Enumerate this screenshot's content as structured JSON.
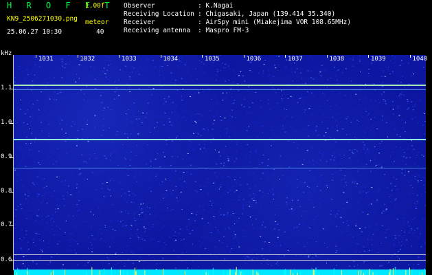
{
  "header": {
    "app_title": "H R O F F T",
    "version": "1.00f",
    "filename": "KN9_2506271030.png",
    "mode": "meteor",
    "datetime": "25.06.27 10:30",
    "count": "40",
    "meta": [
      {
        "label": "Observer",
        "value": ": K.Nagai"
      },
      {
        "label": "Receiving Location",
        "value": ": Chigasaki, Japan (139.414 35.340)"
      },
      {
        "label": "Receiver",
        "value": ": AirSpy mini (Miakejima VOR 108.65MHz)"
      },
      {
        "label": "Receiving antenna",
        "value": ": Maspro FM-3"
      }
    ]
  },
  "plot": {
    "y_unit": "kHz",
    "y_ticks": [
      "1.1",
      "1.0",
      "0.9",
      "0.8",
      "0.7",
      "0.6"
    ],
    "x_ticks": [
      "1031",
      "1032",
      "1033",
      "1034",
      "1035",
      "1036",
      "1037",
      "1038",
      "1039",
      "1040"
    ],
    "colors": {
      "background": "#0c16a0",
      "signal": "#a0ffd0",
      "bottom_bar": "#00e8ff"
    }
  }
}
